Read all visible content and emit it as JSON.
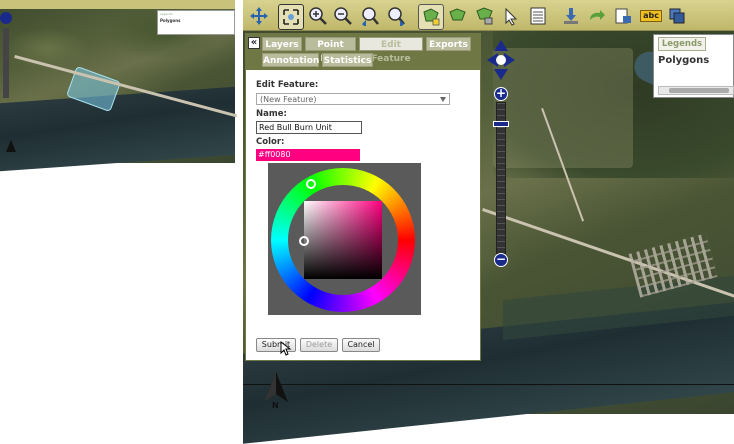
{
  "thumbnail": {
    "legend_tab": "Legends",
    "legend_title": "Polygons"
  },
  "toolbar": {
    "icons": [
      "pan-icon",
      "zoom-extent-icon",
      "zoom-in-icon",
      "zoom-out-icon",
      "zoom-previous-icon",
      "zoom-next-icon",
      "add-polygon-icon",
      "edit-polygon-icon",
      "select-feature-icon",
      "identify-icon",
      "attribute-table-icon",
      "download-icon",
      "redo-arrow-icon",
      "print-icon",
      "label-abc-icon",
      "layer-stack-icon"
    ],
    "label_icon_text": "abc"
  },
  "panel": {
    "collapse_glyph": "«",
    "tabs_row1": [
      "Layers",
      "Point Edit",
      "Edit Feature",
      "Exports"
    ],
    "tabs_row2": [
      "Annotation",
      "Statistics"
    ],
    "active_tab": "Edit Feature",
    "edit_feature_label": "Edit Feature:",
    "edit_feature_value": "(New Feature)",
    "name_label": "Name:",
    "name_value": "Red Bull Burn Unit",
    "color_label": "Color:",
    "color_value": "#ff0080",
    "buttons": {
      "submit": "Submit",
      "delete": "Delete",
      "cancel": "Cancel"
    }
  },
  "legends": {
    "tab": "Legends",
    "title": "Polygons"
  },
  "nav": {
    "zoom_in": "+",
    "zoom_out": "−"
  },
  "north_label": "N",
  "colors": {
    "toolbar_bg": "#c9c27a",
    "panel_header": "#6f7745",
    "tab_bg": "#b9bd9c",
    "selected_color": "#ff0080"
  }
}
